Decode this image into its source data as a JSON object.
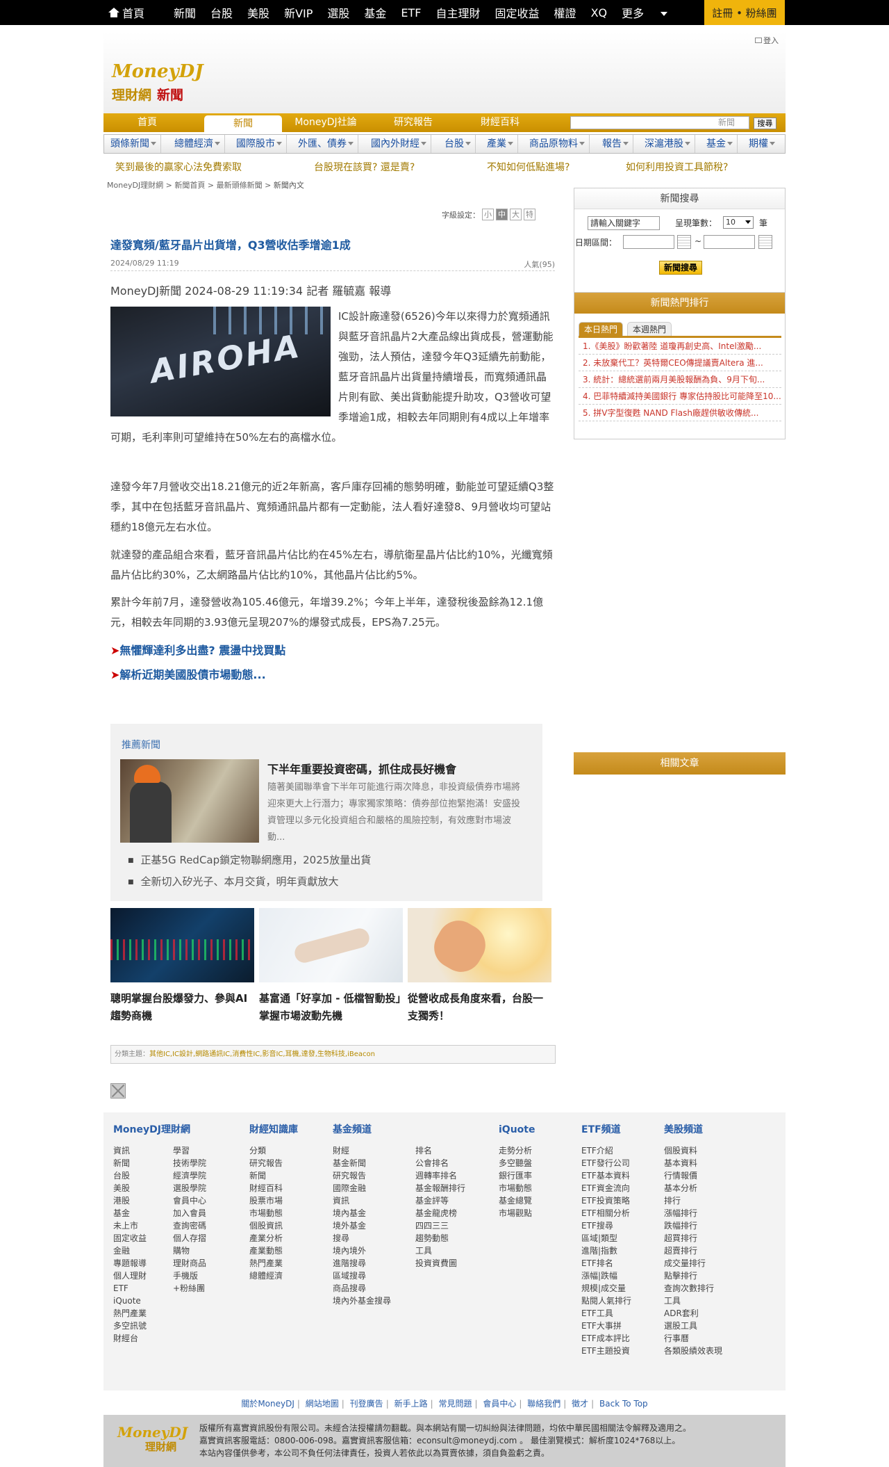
{
  "topbar": {
    "items": [
      "首頁",
      "新聞",
      "台股",
      "美股",
      "新VIP",
      "選股",
      "基金",
      "ETF",
      "自主理財",
      "固定收益",
      "權證",
      "XQ",
      "更多"
    ],
    "register": "註冊 • 粉絲團"
  },
  "masthead": {
    "logo_main": "MoneyDJ",
    "logo_sub": "理財網",
    "logo_news": "新聞",
    "login": "登入"
  },
  "mainnav": {
    "tabs": [
      "首頁",
      "新聞",
      "MoneyDJ社論",
      "研究報告",
      "財經百科"
    ],
    "search_placeholder": "新聞",
    "search_button": "搜尋"
  },
  "subnav": [
    "頭條新聞",
    "總體經濟",
    "國際股市",
    "外匯、債券",
    "國內外財經",
    "台股",
    "產業",
    "商品原物料",
    "報告",
    "深滬港股",
    "基金",
    "期權"
  ],
  "promos": [
    "笑到最後的贏家心法免費索取",
    "台股現在該買? 還是賣?",
    "不知如何低點進場?",
    "如何利用投資工具節稅?"
  ],
  "breadcrumb": [
    "MoneyDJ理財網",
    "新聞首頁",
    "最新頭條新聞",
    "新聞內文"
  ],
  "fontsize": {
    "label": "字級設定：",
    "options": [
      "小",
      "中",
      "大",
      "特"
    ]
  },
  "article": {
    "headline": "達發寬頻/藍牙晶片出貨增，Q3營收估季增逾1成",
    "date": "2024/08/29 11:19",
    "views": "人氣(95)",
    "byline": "MoneyDJ新聞 2024-08-29 11:19:34 記者 羅毓嘉 報導",
    "image_text": "AIROHA",
    "p1": "IC設計廠達發(6526)今年以來得力於寬頻通訊與藍牙音訊晶片2大產品線出貨成長，營運動能強勁，法人預估，達發今年Q3延續先前動能，藍牙音訊晶片出貨量持續增長，而寬頻通訊晶片則有歐、美出貨動能提升助攻，Q3營收可望季增逾1成，相較去年同期則有4成以上年增率可期，毛利率則可望維持在50%左右的高檔水位。",
    "p2": "達發今年7月營收交出18.21億元的近2年新高，客戶庫存回補的態勢明確，動能並可望延續Q3整季，其中在包括藍牙音訊晶片、寬頻通訊晶片都有一定動能，法人看好達發8、9月營收均可望站穩約18億元左右水位。",
    "p3": "就達發的產品組合來看，藍牙音訊晶片佔比約在45%左右，導航衛星晶片佔比約10%，光纖寬頻晶片佔比約30%，乙太網路晶片佔比約10%，其他晶片佔比約5%。",
    "p4": "累計今年前7月，達發營收為105.46億元，年增39.2%；今年上半年，達發稅後盈餘為12.1億元，相較去年同期的3.93億元呈現207%的爆發式成長，EPS為7.25元。",
    "link1": "無懼輝達利多出盡? 震盪中找買點",
    "link2": "解析近期美國股債市場動態..."
  },
  "recommend": {
    "label": "推薦新聞",
    "title": "下半年重要投資密碼，抓住成長好機會",
    "desc": "隨著美國聯準會下半年可能進行兩次降息，非投資級債券市場將迎來更大上行潛力；專家獨家策略：債券部位抱緊抱滿！安盛投資管理以多元化投資組合和嚴格的風險控制，有效應對市場波動...",
    "bullets": [
      "正基5G RedCap鎖定物聯網應用，2025放量出貨",
      "全新切入矽光子、本月交貨，明年貢獻放大"
    ]
  },
  "tiles": [
    "聰明掌握台股爆發力、參與AI趨勢商機",
    "基富通「好享加 - 低檔智動投」掌握市場波動先機",
    "從營收成長角度來看，台股一支獨秀！"
  ],
  "tags": {
    "label": "分類主題：",
    "value": "其他IC,IC設計,網路通訊IC,消費性IC,影音IC,耳機,達發,生物科技,iBeacon"
  },
  "sidebar": {
    "search": {
      "title": "新聞搜尋",
      "keyword": "請輸入關鍵字",
      "count_label": "呈現筆數：",
      "count_value": "10",
      "unit": "筆",
      "date_label": "日期區間：",
      "tilde": "~",
      "button": "新聞搜尋"
    },
    "hot": {
      "title": "新聞熱門排行",
      "tabs": [
        "本日熱門",
        "本週熱門"
      ],
      "items": [
        "1.《美股》盼歡著陸 道瓊再創史高、Intel激勵...",
        "2. 未放棄代工？英特爾CEO傳提議賣Altera 進...",
        "3. 統計：總統選前兩月美股報酬為負、9月下旬...",
        "4. 巴菲特續減持美國銀行 專家估持股比可能降至10...",
        "5. 拼V字型復甦 NAND Flash廠趕供敏收傳統..."
      ]
    },
    "related": "相關文章"
  },
  "footer": {
    "columns": [
      {
        "h": "MoneyDJ理財網"
      },
      {
        "h": "財經知識庫"
      },
      {
        "h": "基金頻道"
      },
      {
        "h": "iQuote"
      },
      {
        "h": "ETF頻道"
      },
      {
        "h": "美股頻道"
      }
    ],
    "c1a": [
      "資訊",
      "新聞",
      "台股",
      "美股",
      "港股",
      "基金",
      "未上市",
      "固定收益",
      "金融",
      "專題報導",
      "個人理財",
      "ETF",
      "iQuote",
      "熱門產業",
      "多空訊號",
      "財經台"
    ],
    "c1b": [
      "學習",
      "技術學院",
      "經濟學院",
      "選股學院",
      "",
      "會員中心",
      "加入會員",
      "查詢密碼",
      "個人存摺",
      "",
      "購物",
      "理財商品",
      "",
      "手機版",
      "+粉絲團"
    ],
    "c2": [
      "分類",
      "研究報告",
      "新聞",
      "財經百科",
      "",
      "股票市場",
      "市場動態",
      "個股資訊",
      "產業分析",
      "產業動態",
      "熱門產業",
      "總體經濟"
    ],
    "c3a": [
      "財經",
      "基金新聞",
      "研究報告",
      "國際金融",
      "",
      "資訊",
      "境內基金",
      "境外基金",
      "",
      "搜尋",
      "境內境外",
      "進階搜尋",
      "區域搜尋",
      "商品搜尋",
      "境內外基金搜尋"
    ],
    "c3b": [
      "排名",
      "公會排名",
      "週轉率排名",
      "基金報酬排行",
      "基金評等",
      "基金龍虎榜",
      "四四三三",
      "趨勢動態",
      "",
      "工具",
      "投資資費圖"
    ],
    "c4": [
      "走勢分析",
      "多空聽盤",
      "銀行匯率",
      "市場動態",
      "基金總覽",
      "市場觀點"
    ],
    "c5": [
      "ETF介紹",
      "ETF發行公司",
      "ETF基本資料",
      "ETF資金流向",
      "ETF投資策略",
      "ETF相關分析",
      "",
      "ETF搜尋",
      "區域|類型",
      "進階|指數",
      "",
      "ETF排名",
      "漲幅|跌幅",
      "規模|成交量",
      "點閱人氣排行",
      "",
      "ETF工具",
      "ETF大事拼",
      "ETF成本評比",
      "ETF主題投資"
    ],
    "c6": [
      "個股資料",
      "基本資料",
      "行情報價",
      "基本分析",
      "",
      "排行",
      "漲幅排行",
      "跌幅排行",
      "超買排行",
      "超賣排行",
      "成交量排行",
      "點擊排行",
      "查詢次數排行",
      "",
      "工具",
      "ADR套利",
      "選股工具",
      "行事曆",
      "各類股績效表現"
    ],
    "links": [
      "關於MoneyDJ",
      "網站地圖",
      "刊登廣告",
      "新手上路",
      "常見問題",
      "會員中心",
      "聯絡我們",
      "徵才",
      "Back To Top"
    ],
    "copy1": "版權所有嘉實資訊股份有限公司。未經合法授權請勿翻載。與本網站有關一切糾紛與法律問題，均依中華民國相關法令解釋及適用之。",
    "copy2": "嘉實資訊客服電話：0800-006-098。嘉實資訊客服信箱：econsult@moneydj.com 。 最佳瀏覽模式：解析度1024*768以上。",
    "copy3": "本站內容僅供參考，本公司不負任何法律責任，投資人若依此以為買賣依據，須自負盈虧之責。",
    "logo": "MoneyDJ",
    "logo_sub": "理財網"
  }
}
